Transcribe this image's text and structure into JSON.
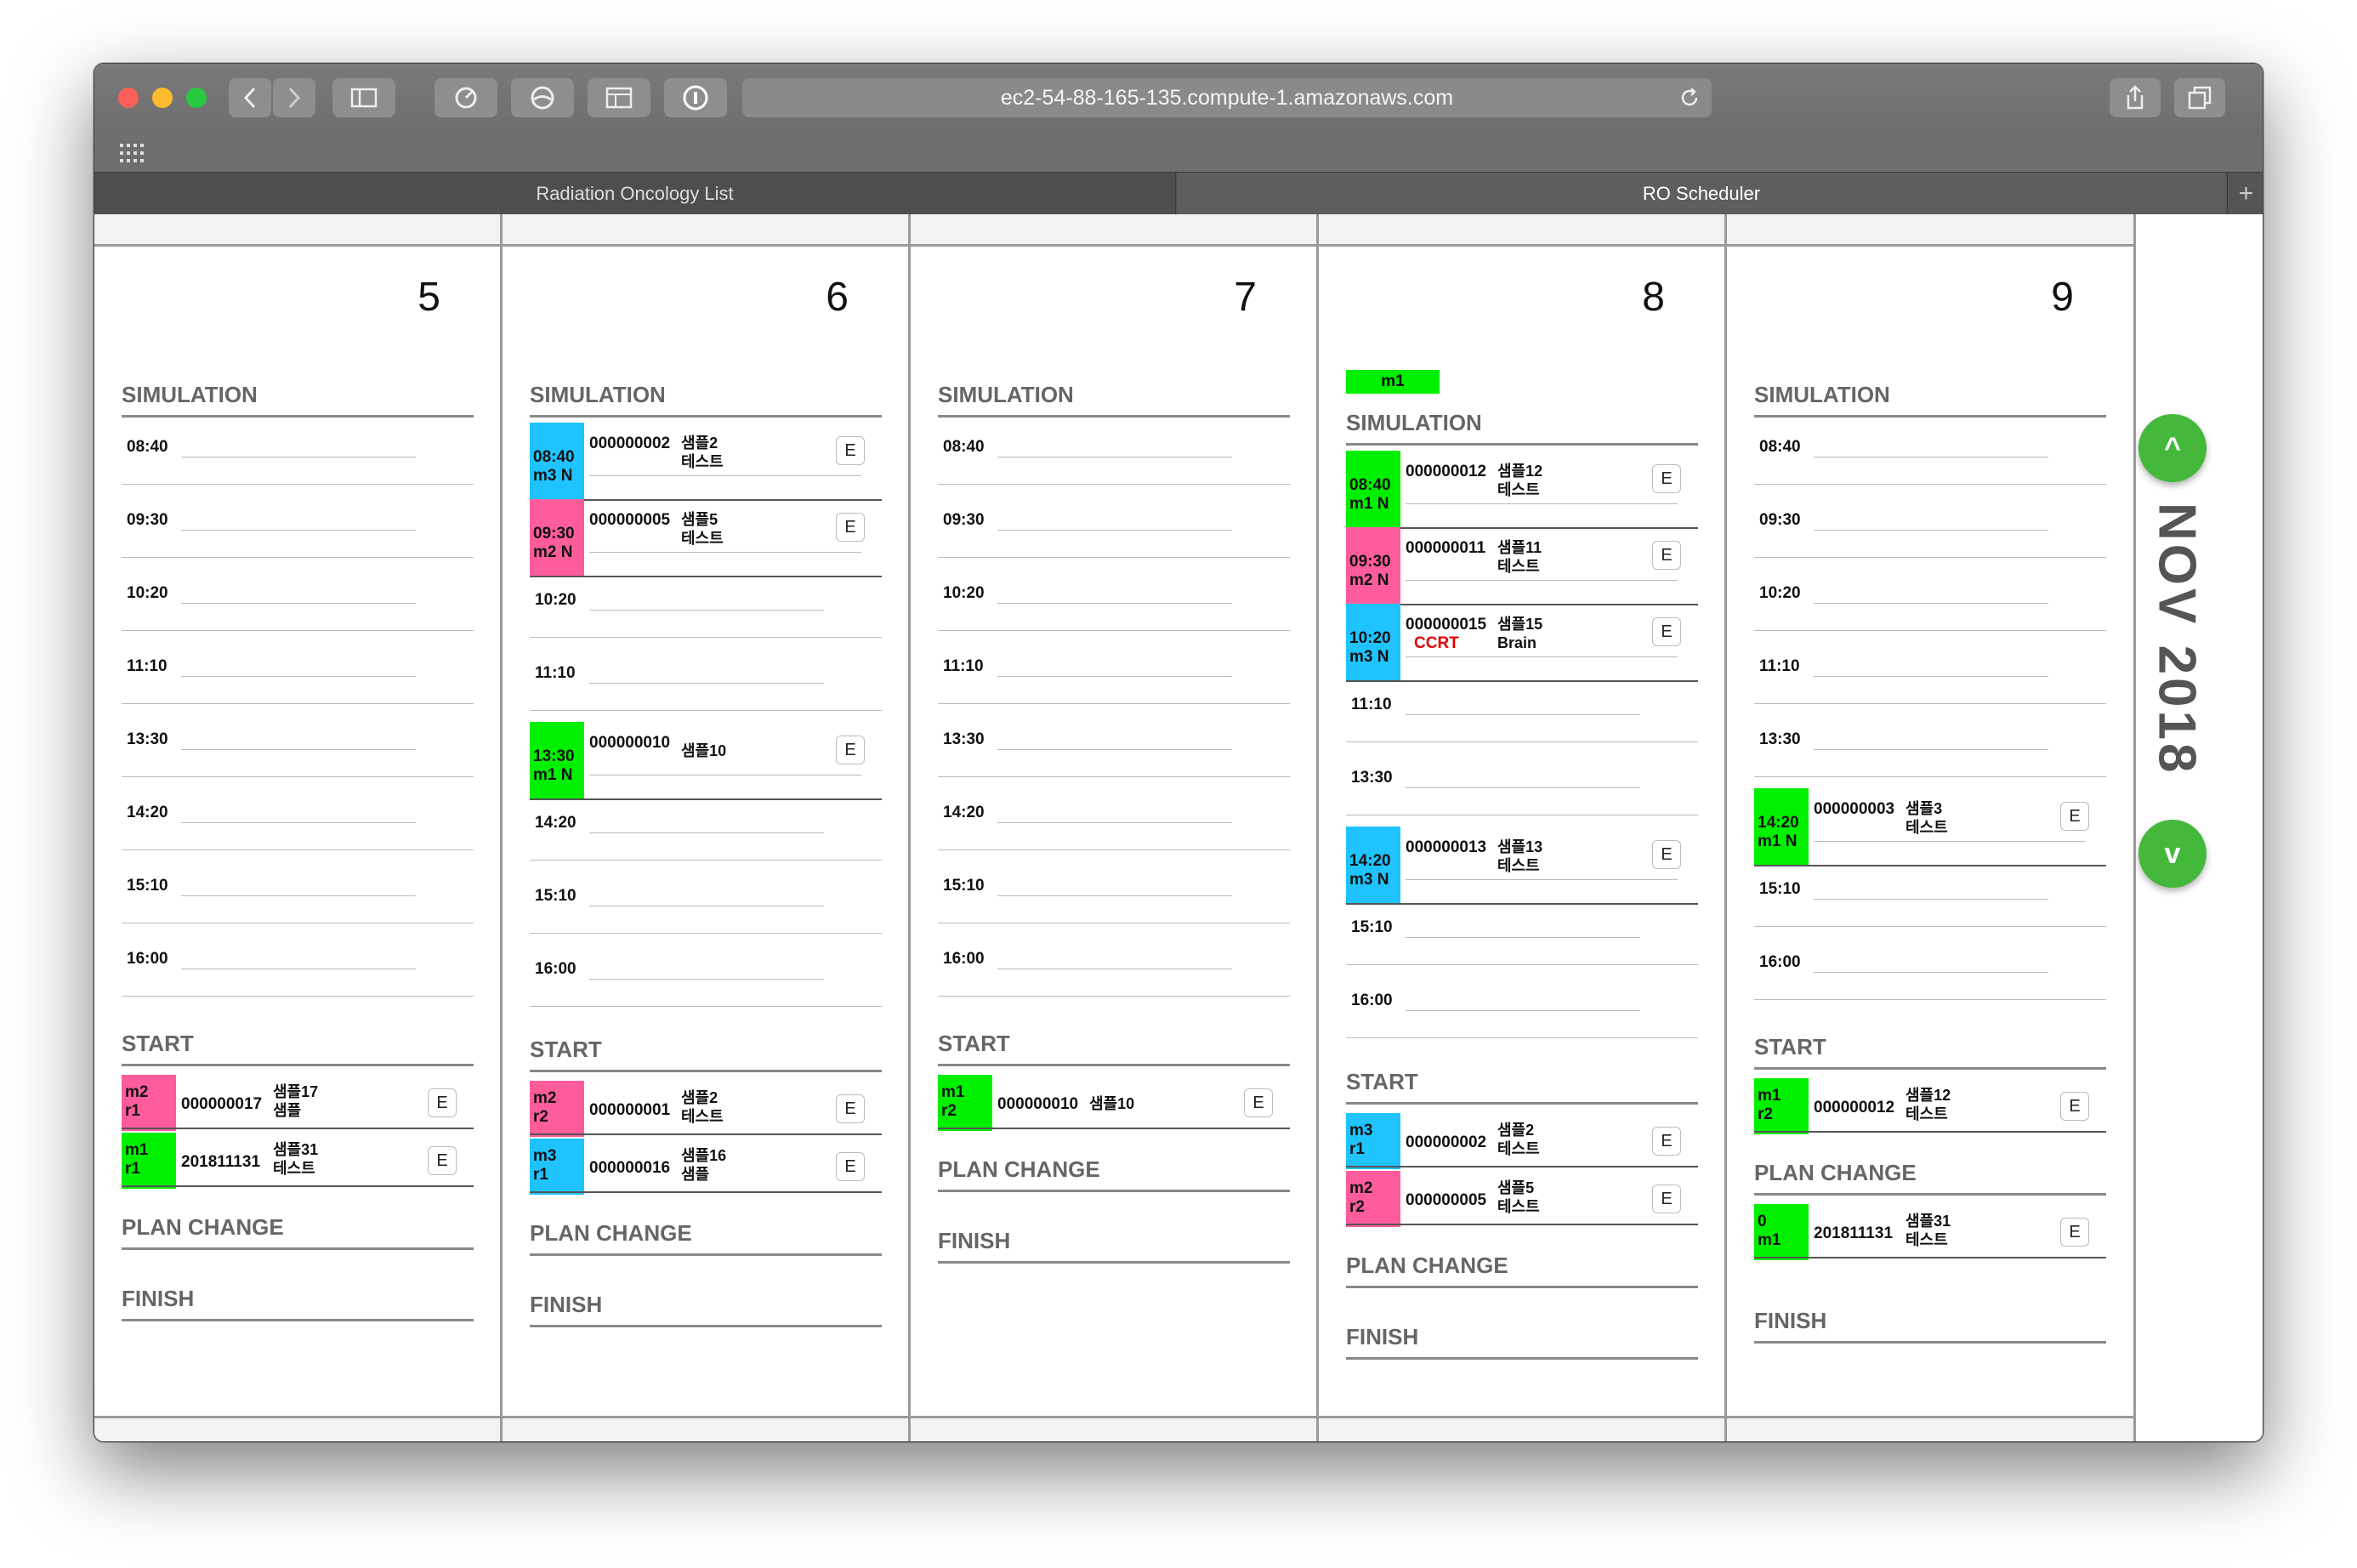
{
  "browser": {
    "url": "ec2-54-88-165-135.compute-1.amazonaws.com",
    "tabs": [
      "Radiation Oncology List",
      "RO Scheduler"
    ],
    "new_tab": "+"
  },
  "nav": {
    "month": "NOV 2018",
    "up": "^",
    "down": "v"
  },
  "sections": {
    "simulation": "SIMULATION",
    "start": "START",
    "plan_change": "PLAN CHANGE",
    "finish": "FINISH",
    "edit": "E"
  },
  "days": [
    {
      "day": "5",
      "simulation": [
        {
          "time": "08:40"
        },
        {
          "time": "09:30"
        },
        {
          "time": "10:20"
        },
        {
          "time": "11:10"
        },
        {
          "time": "13:30"
        },
        {
          "time": "14:20"
        },
        {
          "time": "15:10"
        },
        {
          "time": "16:00"
        }
      ],
      "start": [
        {
          "badge1": "m2",
          "badge2": "r1",
          "color": "pink",
          "id": "000000017",
          "name1": "샘플17",
          "name2": "샘플"
        },
        {
          "badge1": "m1",
          "badge2": "r1",
          "color": "green",
          "id": "201811131",
          "name1": "샘플31",
          "name2": "테스트"
        }
      ],
      "plan_change": [],
      "finish": []
    },
    {
      "day": "6",
      "simulation": [
        {
          "time": "08:40",
          "machine": "m3 N",
          "color": "blue",
          "id": "000000002",
          "name1": "샘플2",
          "name2": "테스트"
        },
        {
          "time": "09:30",
          "machine": "m2 N",
          "color": "pink",
          "id": "000000005",
          "name1": "샘플5",
          "name2": "테스트"
        },
        {
          "time": "10:20"
        },
        {
          "time": "11:10"
        },
        {
          "time": "13:30",
          "machine": "m1 N",
          "color": "green",
          "id": "000000010",
          "name1": "샘플10",
          "name2": ""
        },
        {
          "time": "14:20"
        },
        {
          "time": "15:10"
        },
        {
          "time": "16:00"
        }
      ],
      "start": [
        {
          "badge1": "m2",
          "badge2": "r2",
          "color": "pink",
          "id": "000000001",
          "name1": "샘플2",
          "name2": "테스트"
        },
        {
          "badge1": "m3",
          "badge2": "r1",
          "color": "blue",
          "id": "000000016",
          "name1": "샘플16",
          "name2": "샘플"
        }
      ],
      "plan_change": [],
      "finish": []
    },
    {
      "day": "7",
      "simulation": [
        {
          "time": "08:40"
        },
        {
          "time": "09:30"
        },
        {
          "time": "10:20"
        },
        {
          "time": "11:10"
        },
        {
          "time": "13:30"
        },
        {
          "time": "14:20"
        },
        {
          "time": "15:10"
        },
        {
          "time": "16:00"
        }
      ],
      "start": [
        {
          "badge1": "m1",
          "badge2": "r2",
          "color": "green",
          "id": "000000010",
          "name1": "샘플10",
          "name2": ""
        }
      ],
      "plan_change": [],
      "finish": []
    },
    {
      "day": "8",
      "tag": "m1",
      "simulation": [
        {
          "time": "08:40",
          "machine": "m1 N",
          "color": "green",
          "id": "000000012",
          "name1": "샘플12",
          "name2": "테스트"
        },
        {
          "time": "09:30",
          "machine": "m2 N",
          "color": "pink",
          "id": "000000011",
          "name1": "샘플11",
          "name2": "테스트"
        },
        {
          "time": "10:20",
          "machine": "m3 N",
          "color": "blue",
          "id": "000000015",
          "note": "CCRT",
          "name1": "샘플15",
          "name2": "Brain"
        },
        {
          "time": "11:10"
        },
        {
          "time": "13:30"
        },
        {
          "time": "14:20",
          "machine": "m3 N",
          "color": "blue",
          "id": "000000013",
          "name1": "샘플13",
          "name2": "테스트"
        },
        {
          "time": "15:10"
        },
        {
          "time": "16:00"
        }
      ],
      "start": [
        {
          "badge1": "m3",
          "badge2": "r1",
          "color": "blue",
          "id": "000000002",
          "name1": "샘플2",
          "name2": "테스트"
        },
        {
          "badge1": "m2",
          "badge2": "r2",
          "color": "pink",
          "id": "000000005",
          "name1": "샘플5",
          "name2": "테스트"
        }
      ],
      "plan_change": [],
      "finish": []
    },
    {
      "day": "9",
      "simulation": [
        {
          "time": "08:40"
        },
        {
          "time": "09:30"
        },
        {
          "time": "10:20"
        },
        {
          "time": "11:10"
        },
        {
          "time": "13:30"
        },
        {
          "time": "14:20",
          "machine": "m1 N",
          "color": "green",
          "id": "000000003",
          "name1": "샘플3",
          "name2": "테스트"
        },
        {
          "time": "15:10"
        },
        {
          "time": "16:00"
        }
      ],
      "start": [
        {
          "badge1": "m1",
          "badge2": "r2",
          "color": "green",
          "id": "000000012",
          "name1": "샘플12",
          "name2": "테스트"
        }
      ],
      "plan_change": [
        {
          "badge1": "0",
          "badge2": "m1",
          "color": "green",
          "id": "201811131",
          "name1": "샘플31",
          "name2": "테스트"
        }
      ],
      "finish": []
    }
  ]
}
